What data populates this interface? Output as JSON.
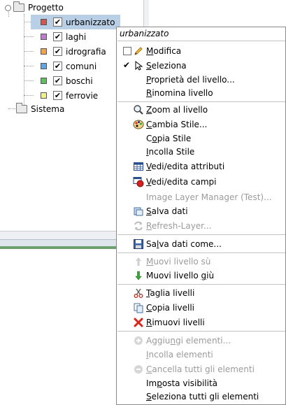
{
  "tree": {
    "root_label": "Progetto",
    "layers": [
      {
        "label": "urbanizzato",
        "color": "#d9534f",
        "checked": true,
        "selected": true
      },
      {
        "label": "laghi",
        "color": "#c07ad0",
        "checked": true
      },
      {
        "label": "idrografia",
        "color": "#f5a14a",
        "checked": true
      },
      {
        "label": "comuni",
        "color": "#5fa8e8",
        "checked": true
      },
      {
        "label": "boschi",
        "color": "#5cc25c",
        "checked": true
      },
      {
        "label": "ferrovie",
        "color": "#f3f08a",
        "checked": true
      }
    ],
    "system_label": "Sistema",
    "check_glyph": "✔"
  },
  "menu": {
    "title": "urbanizzato",
    "items": {
      "modifica": {
        "pre": "",
        "u": "M",
        "post": "odifica",
        "checkbox": "☐",
        "icon": "pencil-icon"
      },
      "seleziona": {
        "pre": "",
        "u": "S",
        "post": "eleziona",
        "checkbox": "✔",
        "icon": "cursor-icon"
      },
      "proprieta": {
        "pre": "",
        "u": "P",
        "post": "roprietà del livello..."
      },
      "rinomina": {
        "pre": "",
        "u": "R",
        "post": "inomina livello"
      },
      "zoom": {
        "pre": "",
        "u": "Z",
        "post": "oom al livello",
        "icon": "zoom-icon"
      },
      "cambia_stile": {
        "pre": "",
        "u": "C",
        "post": "ambia Stile...",
        "icon": "palette-icon"
      },
      "copia_stile": {
        "pre": "C",
        "u": "o",
        "post": "pia Stile"
      },
      "incolla_stile": {
        "pre": "",
        "u": "I",
        "post": "ncolla Stile"
      },
      "vedi_attributi": {
        "pre": "",
        "u": "V",
        "post": "edi/edita attributi",
        "icon": "table-icon"
      },
      "vedi_campi": {
        "pre": "",
        "u": "V",
        "post": "edi/edita campi",
        "icon": "fields-icon"
      },
      "image_layer": {
        "pre": "Image Layer Manager (Test)...",
        "u": "",
        "post": "",
        "disabled": true
      },
      "salva_dati": {
        "pre": "",
        "u": "S",
        "post": "alva dati",
        "icon": "save-data-icon"
      },
      "refresh": {
        "pre": "",
        "u": "R",
        "post": "efresh-Layer...",
        "disabled": true,
        "icon": "refresh-icon"
      },
      "salva_come": {
        "pre": "Sa",
        "u": "l",
        "post": "va dati come...",
        "icon": "floppy-icon"
      },
      "muovi_su": {
        "pre": "",
        "u": "M",
        "post": "uovi livello sù",
        "disabled": true,
        "icon": "arrow-up-icon"
      },
      "muovi_giu": {
        "pre": "Muovi livello ",
        "u": "g",
        "post": "iù",
        "icon": "arrow-down-icon"
      },
      "taglia": {
        "pre": "",
        "u": "T",
        "post": "aglia livelli",
        "icon": "scissors-icon"
      },
      "copia_livelli": {
        "pre": "",
        "u": "C",
        "post": "opia livelli",
        "icon": "copy-icon"
      },
      "rimuovi": {
        "pre": "",
        "u": "R",
        "post": "imuovi  livelli",
        "icon": "delete-icon"
      },
      "aggiungi": {
        "pre": "Aggiu",
        "u": "n",
        "post": "gi elementi...",
        "disabled": true,
        "icon": "add-icon"
      },
      "incolla_elementi": {
        "pre": "",
        "u": "I",
        "post": "ncolla elementi",
        "disabled": true
      },
      "cancella": {
        "pre": "",
        "u": "C",
        "post": "ancella tutti gli elementi",
        "disabled": true,
        "icon": "remove-icon"
      },
      "imposta": {
        "pre": "Im",
        "u": "p",
        "post": "osta visibilità"
      },
      "seleziona_tutti": {
        "pre": "",
        "u": "S",
        "post": "eleziona tutti gli elementi"
      }
    }
  },
  "colors": {
    "selection": "#b8cfe5",
    "disabled_text": "#9b9b9b",
    "status_bar_green": "#6da06d"
  }
}
